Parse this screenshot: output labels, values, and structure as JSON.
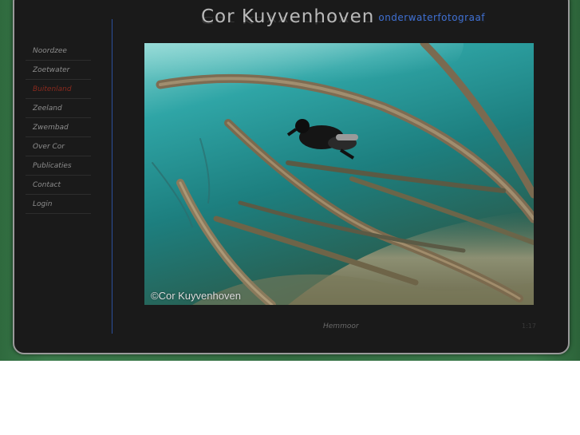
{
  "site": {
    "title": "Cor Kuyvenhoven",
    "subtitle": "onderwaterfotograaf"
  },
  "nav": {
    "items": [
      {
        "label": "Noordzee"
      },
      {
        "label": "Zoetwater"
      },
      {
        "label": "Buitenland",
        "active": true
      },
      {
        "label": "Zeeland"
      },
      {
        "label": "Zwembad"
      },
      {
        "label": "Over Cor"
      },
      {
        "label": "Publicaties"
      },
      {
        "label": "Contact"
      },
      {
        "label": "Login"
      }
    ]
  },
  "photo": {
    "watermark": "©Cor Kuyvenhoven",
    "caption": "Hemmoor",
    "counter": "1:17"
  },
  "colors": {
    "background_green": "#356f43",
    "panel": "#1a1a1a",
    "accent_blue": "#3f6fd0",
    "active_nav": "#8a2a1e"
  }
}
